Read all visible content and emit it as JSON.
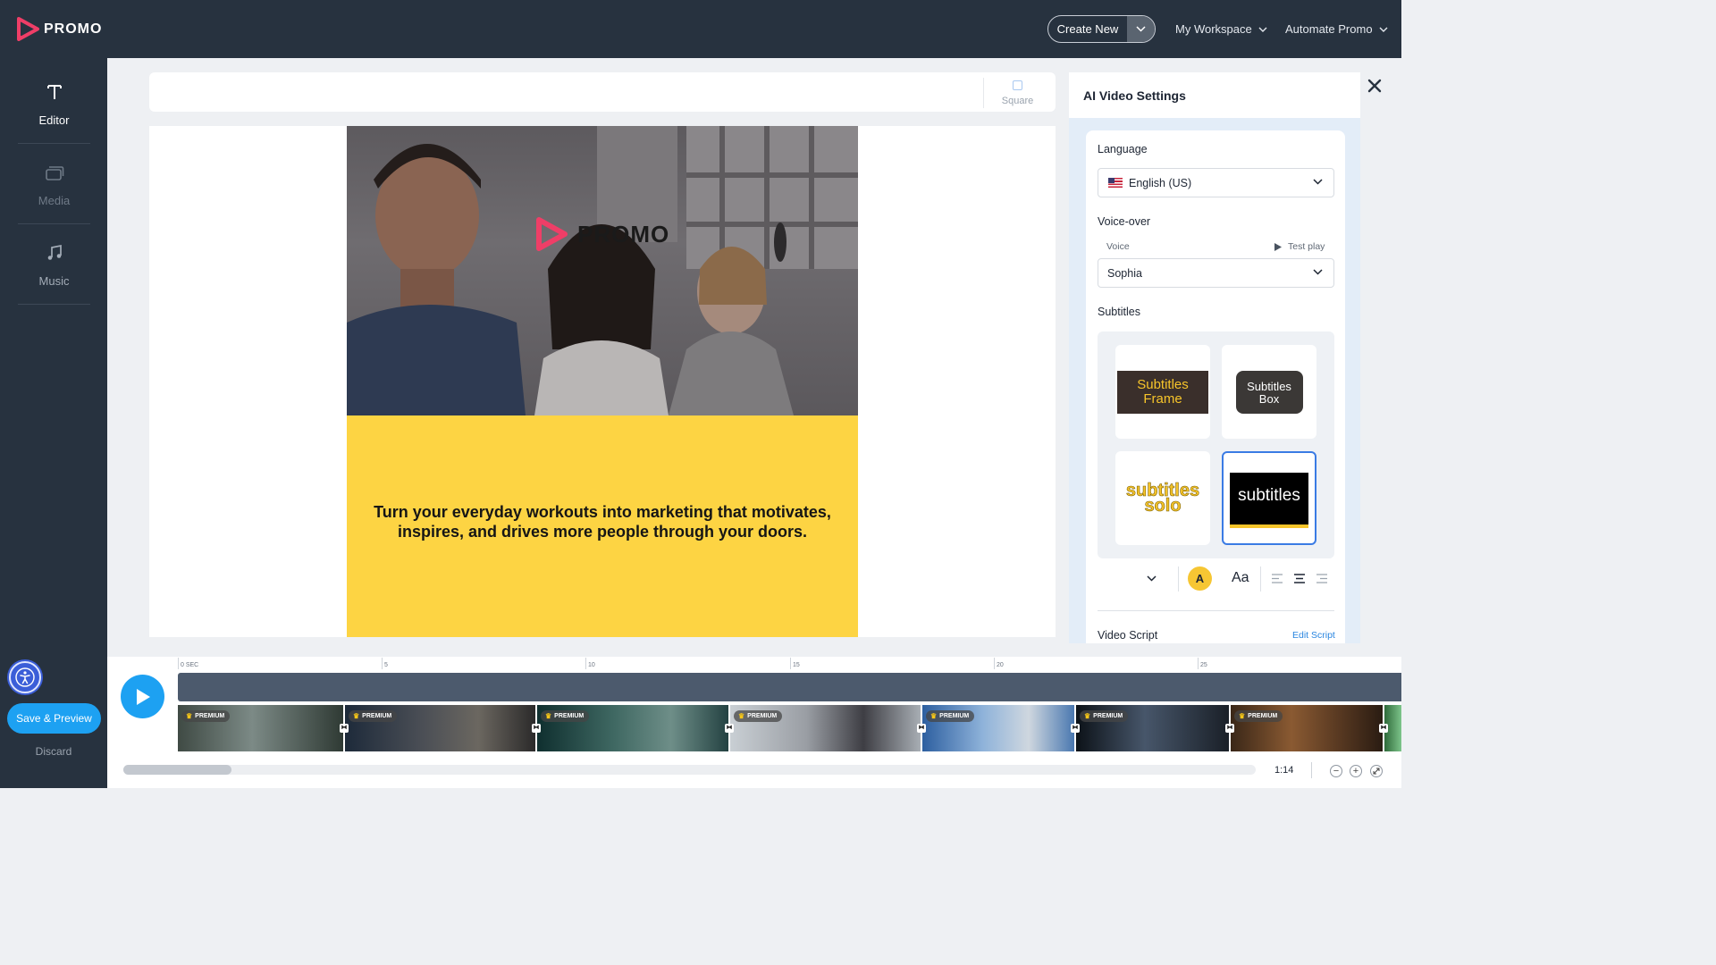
{
  "app": {
    "brand": "PROMO"
  },
  "header": {
    "create_new": "Create New",
    "workspace": "My Workspace",
    "automate": "Automate Promo"
  },
  "sidebar": {
    "items": [
      {
        "label": "Editor",
        "icon": "text-icon"
      },
      {
        "label": "Media",
        "icon": "media-icon"
      },
      {
        "label": "Music",
        "icon": "music-icon"
      }
    ],
    "save_preview": "Save & Preview",
    "discard": "Discard"
  },
  "canvas": {
    "format_label": "Square",
    "brand_word": "PROMO",
    "caption": "Turn your everyday workouts into marketing that motivates, inspires, and drives more people through your doors."
  },
  "settings": {
    "title": "AI Video Settings",
    "language_label": "Language",
    "language_value": "English (US)",
    "voiceover_label": "Voice-over",
    "voice_label": "Voice",
    "test_play": "Test play",
    "voice_value": "Sophia",
    "subtitles_label": "Subtitles",
    "subtitle_styles": [
      {
        "name": "Subtitles Frame"
      },
      {
        "name": "Subtitles Box"
      },
      {
        "name": "subtitles solo"
      },
      {
        "name": "subtitles",
        "selected": true
      }
    ],
    "color_letter": "A",
    "font_glyph": "Aa",
    "alignment_selected": "center",
    "video_script_label": "Video Script",
    "edit_script": "Edit Script"
  },
  "timeline": {
    "ruler": [
      "0 SEC",
      "5",
      "10",
      "15",
      "20",
      "25"
    ],
    "premium_label": "PREMIUM",
    "clips": 7,
    "duration": "1:14"
  },
  "colors": {
    "topbar": "#27323f",
    "accent": "#1da1f2",
    "panel_yellow": "#fdd443",
    "brand_pink": "#ef3e67"
  }
}
